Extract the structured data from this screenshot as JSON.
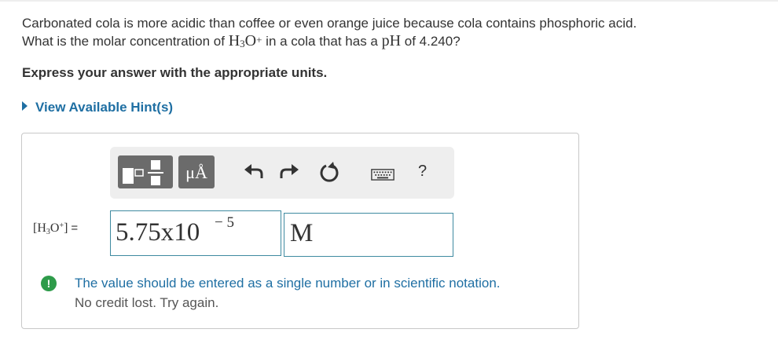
{
  "question": {
    "line1": "Carbonated cola is more acidic than coffee or even orange juice because cola contains phosphoric acid.",
    "line2_prefix": "What is the molar concentration of ",
    "h3o_main": "H",
    "h3o_sub": "3",
    "h3o_o": "O",
    "h3o_sup": "+",
    "line2_mid": " in a cola that has a ",
    "ph": "pH",
    "line2_suffix": " of 4.240?"
  },
  "instruction": "Express your answer with the appropriate units.",
  "hint": {
    "label": "View Available Hint(s)"
  },
  "toolbar": {
    "units_button_label": "μÅ",
    "help_label": "?",
    "icons": [
      "templates-icon",
      "units-icon",
      "undo-icon",
      "redo-icon",
      "reset-icon",
      "keyboard-icon",
      "help-icon"
    ]
  },
  "answer": {
    "label_open": "[H",
    "label_sub": "3",
    "label_o": "O",
    "label_sup": "+",
    "label_close": "]",
    "equals": "=",
    "value": "5.75x10",
    "exponent": "− 5",
    "unit": "M"
  },
  "feedback": {
    "icon": "!",
    "line1": "The value should be entered as a single number or in scientific notation.",
    "line2": "No credit lost. Try again.",
    "accent_color": "#2e9b4a",
    "text_color": "#1f6fa3"
  }
}
